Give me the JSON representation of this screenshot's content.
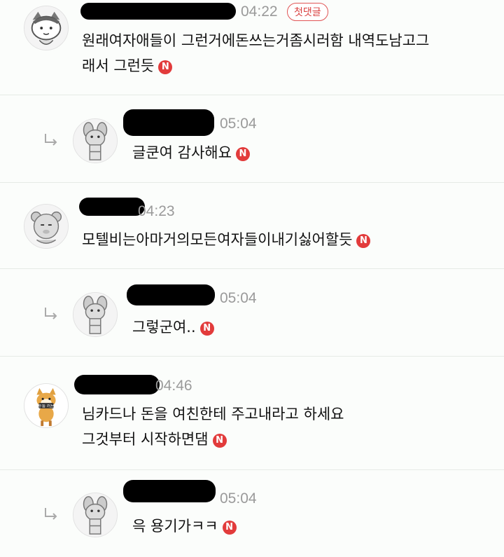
{
  "comments": [
    {
      "time": "04:22",
      "badge": "첫댓글",
      "text_line1": "원래여자애들이 그런거에돈쓰는거좀시러함 내역도남고그",
      "text_line2": "래서 그런듯",
      "new_icon": "N"
    },
    {
      "time": "05:04",
      "text": "글쿤여 감사해요",
      "new_icon": "N"
    },
    {
      "time": "04:23",
      "text": "모텔비는아마거의모든여자들이내기싫어할듯",
      "new_icon": "N"
    },
    {
      "time": "05:04",
      "text": "그렇군여..",
      "new_icon": "N"
    },
    {
      "time": "04:46",
      "text_line1": "님카드나 돈을 여친한테 주고내라고 하세요",
      "text_line2": "그것부터 시작하면댐",
      "new_icon": "N"
    },
    {
      "time": "05:04",
      "text": "윽 용기가ㅋㅋ",
      "new_icon": "N"
    }
  ],
  "avatar_labels": {
    "dog": "두둥 러브"
  },
  "colors": {
    "accent_red": "#e23b3b",
    "timestamp": "#9a9a9a",
    "divider": "#e6ebe6"
  }
}
